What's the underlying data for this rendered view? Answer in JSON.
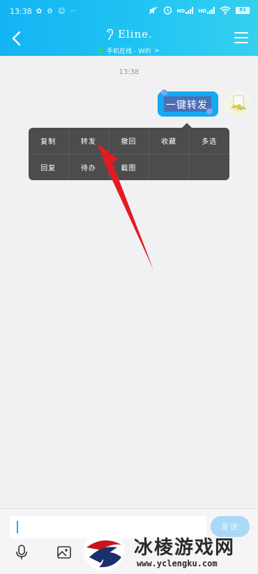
{
  "status_bar": {
    "time": "13:38",
    "notifications": [
      "✿",
      "⚙",
      "☺",
      "···"
    ],
    "net1": "HD",
    "net2": "HD",
    "battery": "81"
  },
  "header": {
    "contact_name": "Eline.",
    "status_text": "手机在线 - WiFi",
    "status_chevron": ">",
    "colors": {
      "start": "#13b4f4",
      "end": "#36d0f0"
    }
  },
  "chat": {
    "timestamp": "13:38",
    "message": "一键转发",
    "bubble_color": "#14a9f2"
  },
  "context_menu": {
    "items_row1": [
      "复制",
      "转发",
      "撤回",
      "收藏",
      "多选"
    ],
    "items_row2": [
      "回复",
      "待办",
      "截图"
    ]
  },
  "input": {
    "placeholder": "",
    "send_label": "发送"
  },
  "toolbar_icons": [
    "mic-icon",
    "image-icon"
  ],
  "watermark": {
    "title": "冰棱游戏网",
    "url": "www.yclengku.com"
  }
}
